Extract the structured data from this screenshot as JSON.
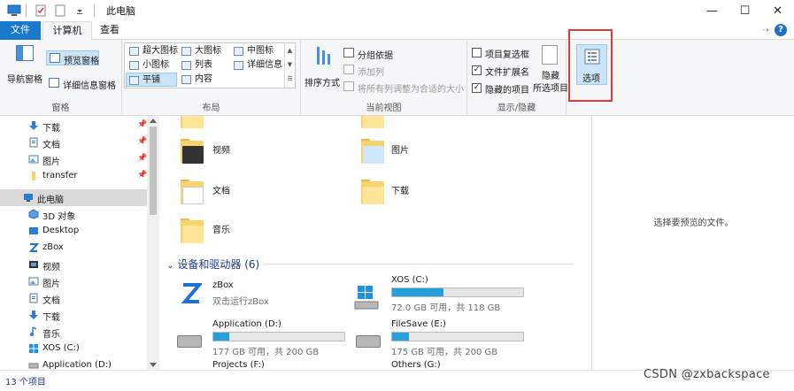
{
  "window": {
    "title": "此电脑",
    "minimize": "—",
    "maximize": "☐",
    "close": "✕"
  },
  "ribbon_tabs": {
    "file": "文件",
    "computer": "计算机",
    "view": "查看",
    "help": "?"
  },
  "ribbon": {
    "panes": {
      "nav_pane": "导航窗格",
      "preview_pane": "预览窗格",
      "details_pane": "详细信息窗格",
      "label": "窗格"
    },
    "layout": {
      "items": [
        "超大图标",
        "大图标",
        "中图标",
        "小图标",
        "列表",
        "详细信息",
        "平铺",
        "内容"
      ],
      "selected": "平铺",
      "label": "布局"
    },
    "current_view": {
      "sort_by": "排序方式",
      "group_by": "分组依据",
      "add_column": "添加列",
      "fit_columns": "将所有列调整为合适的大小",
      "label": "当前视图"
    },
    "show_hide": {
      "item_checkboxes": "项目复选框",
      "file_extensions": "文件扩展名",
      "hidden_items": "隐藏的项目",
      "hide": "隐藏",
      "hide_selected": "所选项目",
      "item_checkboxes_checked": false,
      "file_extensions_checked": true,
      "hidden_items_checked": true,
      "label": "显示/隐藏"
    },
    "options": "选项"
  },
  "nav_pane": {
    "items": [
      {
        "label": "下载",
        "icon": "download-arrow-icon",
        "pinned": true
      },
      {
        "label": "文档",
        "icon": "document-icon",
        "pinned": true
      },
      {
        "label": "图片",
        "icon": "picture-icon",
        "pinned": true
      },
      {
        "label": "transfer",
        "icon": "folder-icon",
        "pinned": true
      },
      {
        "label": "此电脑",
        "icon": "computer-icon",
        "pinned": false,
        "active": true
      },
      {
        "label": "3D 对象",
        "icon": "3d-objects-icon",
        "pinned": false
      },
      {
        "label": "Desktop",
        "icon": "desktop-icon",
        "pinned": false
      },
      {
        "label": "zBox",
        "icon": "zbox-icon",
        "pinned": false
      },
      {
        "label": "视频",
        "icon": "video-icon",
        "pinned": false
      },
      {
        "label": "图片",
        "icon": "picture-icon",
        "pinned": false
      },
      {
        "label": "文档",
        "icon": "document-icon",
        "pinned": false
      },
      {
        "label": "下载",
        "icon": "download-arrow-icon",
        "pinned": false
      },
      {
        "label": "音乐",
        "icon": "music-icon",
        "pinned": false
      },
      {
        "label": "XOS (C:)",
        "icon": "drive-icon",
        "pinned": false
      },
      {
        "label": "Application (D:)",
        "icon": "drive-icon",
        "pinned": false
      }
    ]
  },
  "folders": [
    {
      "label": "视频",
      "icon": "video-folder-icon"
    },
    {
      "label": "图片",
      "icon": "picture-folder-icon"
    },
    {
      "label": "文档",
      "icon": "document-folder-icon"
    },
    {
      "label": "下载",
      "icon": "download-folder-icon"
    },
    {
      "label": "音乐",
      "icon": "music-folder-icon"
    }
  ],
  "devices_section": "设备和驱动器 (6)",
  "devices": [
    {
      "name": "zBox",
      "sub": "双击运行zBox",
      "usage": null
    },
    {
      "name": "XOS (C:)",
      "sub": "72.0 GB 可用，共 118 GB",
      "usage": 0.39
    },
    {
      "name": "Application (D:)",
      "sub": "177 GB 可用，共 200 GB",
      "usage": 0.12
    },
    {
      "name": "FileSave (E:)",
      "sub": "175 GB 可用，共 200 GB",
      "usage": 0.13
    },
    {
      "name": "Projects (F:)",
      "sub": "",
      "usage": null
    },
    {
      "name": "Others (G:)",
      "sub": "",
      "usage": null
    }
  ],
  "preview_pane": {
    "empty_text": "选择要预览的文件。"
  },
  "status": {
    "count": "13 个项目"
  },
  "watermark": "CSDN @zxbackspace",
  "colors": {
    "accent": "#1979ca",
    "selection": "#cce4f7",
    "highlight_box": "#e53935",
    "drive_bar": "#26a0da"
  }
}
